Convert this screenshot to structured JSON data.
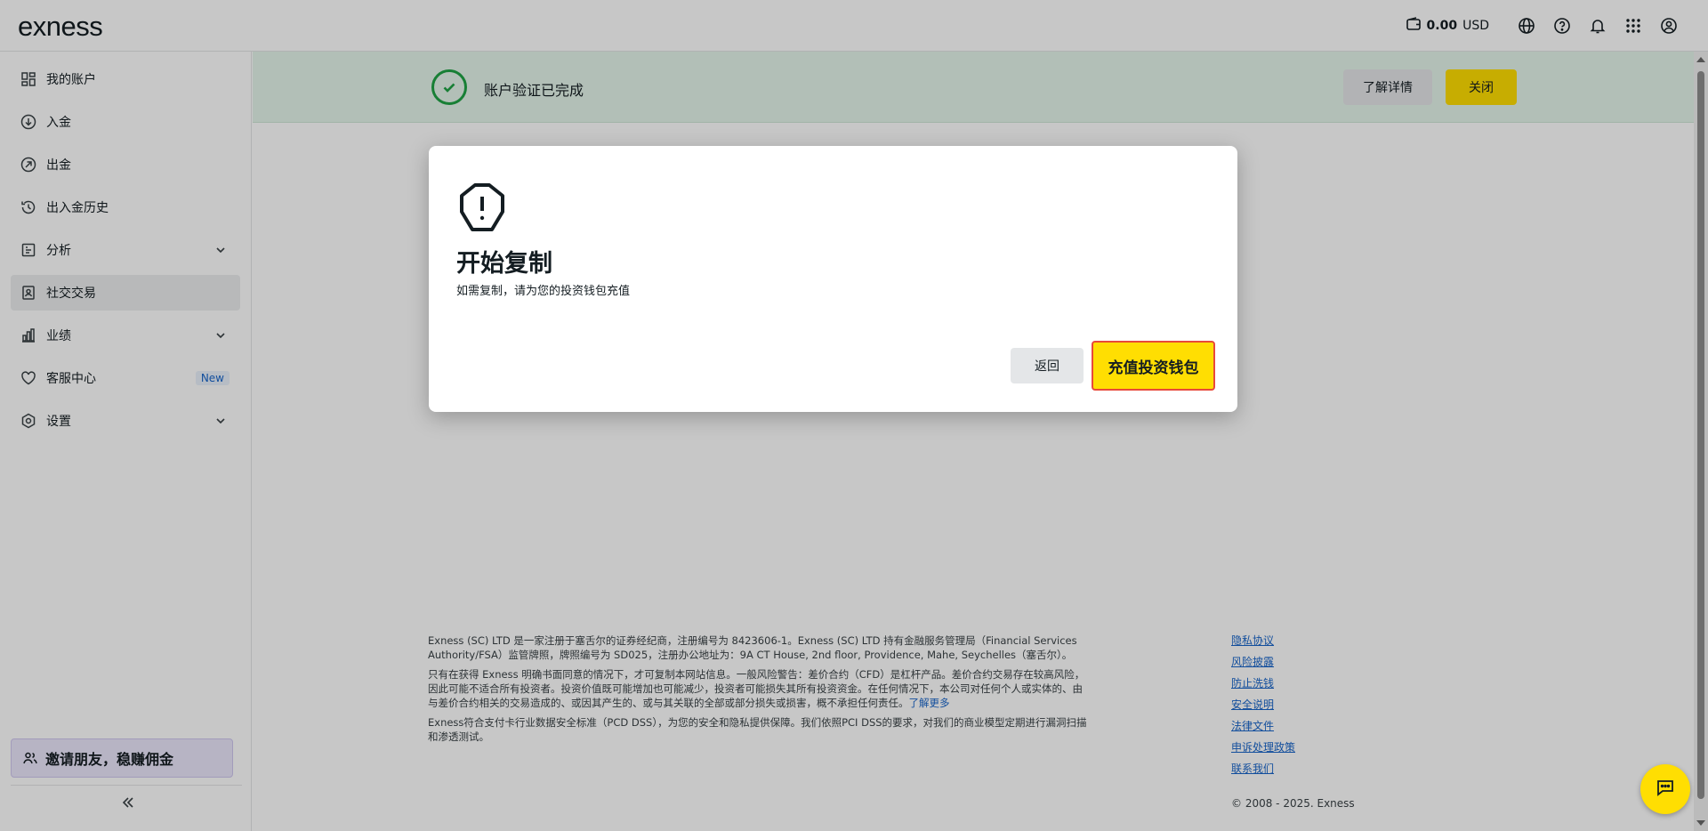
{
  "header": {
    "logo": "exness",
    "balance_amount": "0.00",
    "balance_currency": "USD"
  },
  "sidebar": {
    "items": [
      {
        "label": "我的账户",
        "icon": "grid-icon"
      },
      {
        "label": "入金",
        "icon": "deposit-icon"
      },
      {
        "label": "出金",
        "icon": "withdraw-icon"
      },
      {
        "label": "出入金历史",
        "icon": "history-icon"
      },
      {
        "label": "分析",
        "icon": "analytics-icon",
        "expandable": true
      },
      {
        "label": "社交交易",
        "icon": "social-trading-icon",
        "active": true
      },
      {
        "label": "业绩",
        "icon": "performance-icon",
        "expandable": true
      },
      {
        "label": "客服中心",
        "icon": "heart-icon",
        "badge": "New"
      },
      {
        "label": "设置",
        "icon": "settings-icon",
        "expandable": true
      }
    ],
    "invite_label": "邀请朋友，稳赚佣金"
  },
  "notice": {
    "text": "账户验证已完成",
    "learn_more": "了解详情",
    "close": "关闭"
  },
  "modal": {
    "title": "开始复制",
    "subtitle": "如需复制，请为您的投资钱包充值",
    "back": "返回",
    "deposit": "充值投资钱包"
  },
  "footer": {
    "para1": "Exness (SC) LTD 是一家注册于塞舌尔的证券经纪商，注册编号为 8423606-1。Exness (SC) LTD 持有金融服务管理局（Financial Services Authority/FSA）监管牌照，牌照编号为 SD025，注册办公地址为：9A CT House, 2nd floor, Providence, Mahe, Seychelles（塞舌尔）。",
    "para2": "只有在获得 Exness 明确书面同意的情况下，才可复制本网站信息。一般风险警告：差价合约（CFD）是杠杆产品。差价合约交易存在较高风险，因此可能不适合所有投资者。投资价值既可能增加也可能减少，投资者可能损失其所有投资资金。在任何情况下，本公司对任何个人或实体的、由与差价合约相关的交易造成的、或因其产生的、或与其关联的全部或部分损失或损害，概不承担任何责任。",
    "learn_more_link": "了解更多",
    "para3": "Exness符合支付卡行业数据安全标准（PCD DSS），为您的安全和隐私提供保障。我们依照PCI DSS的要求，对我们的商业模型定期进行漏洞扫描和渗透测试。",
    "links": [
      "隐私协议",
      "风险披露",
      "防止洗钱",
      "安全说明",
      "法律文件",
      "申诉处理政策",
      "联系我们"
    ],
    "copyright": "© 2008 - 2025. Exness"
  },
  "colors": {
    "accent_yellow": "#ffde02",
    "success_green": "#1fa345",
    "link_blue": "#1865c9"
  }
}
